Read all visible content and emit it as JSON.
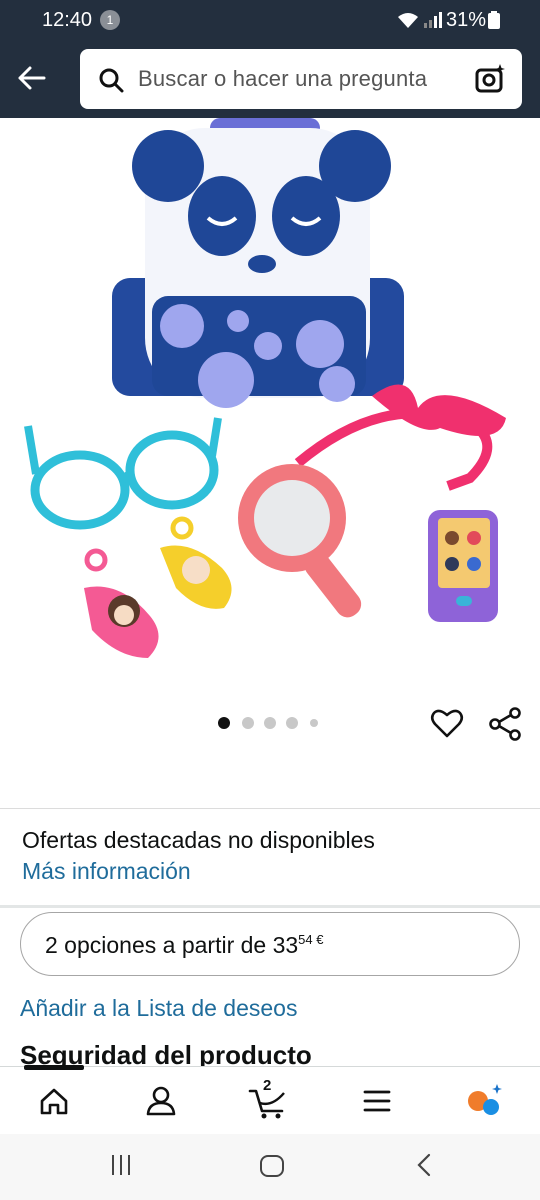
{
  "status_bar": {
    "time": "12:40",
    "notification_count": "1",
    "battery": "31%"
  },
  "search": {
    "placeholder": "Buscar o hacer una pregunta"
  },
  "product": {
    "image_count": 5,
    "active_image": 1
  },
  "offers": {
    "title": "Ofertas destacadas no disponibles",
    "link": "Más información"
  },
  "options": {
    "label": "2 opciones a partir de 33",
    "price_cents": "54 €"
  },
  "wishlist_link": "Añadir a la Lista de deseos",
  "section_title": "Seguridad del producto",
  "bottom_nav": {
    "cart_count": "2",
    "items": [
      "home-icon",
      "account-icon",
      "cart-icon",
      "menu-icon",
      "assistant-icon"
    ]
  },
  "colors": {
    "header_bg": "#232f3e",
    "link": "#1f6c9b",
    "text": "#0f1111"
  }
}
